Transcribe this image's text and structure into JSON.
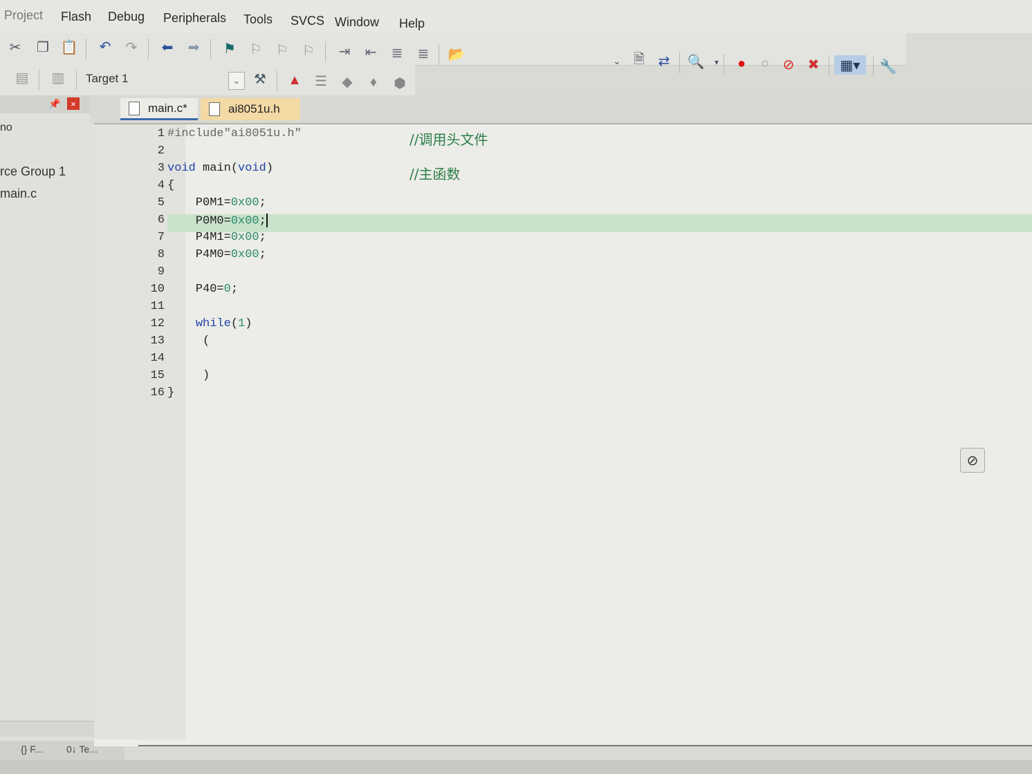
{
  "menu": [
    "Project",
    "Flash",
    "Debug",
    "Peripherals",
    "Tools",
    "SVCS",
    "Window",
    "Help"
  ],
  "toolbar": {
    "target": "Target 1"
  },
  "project_panel": {
    "items": [
      "no",
      "rce Group 1",
      "main.c"
    ]
  },
  "bottom_tabs": [
    "{} F...",
    "0↓ Te..."
  ],
  "tabs": [
    {
      "label": "main.c*",
      "active": true
    },
    {
      "label": "ai8051u.h",
      "active": false
    }
  ],
  "editor": {
    "line_numbers": [
      "1",
      "2",
      "3",
      "4",
      "5",
      "6",
      "7",
      "8",
      "9",
      "10",
      "11",
      "12",
      "13",
      "14",
      "15",
      "16"
    ],
    "code": {
      "l1_pp": "#include\"ai8051u.h\"",
      "l1_comment": "//调用头文件",
      "l3_kw1": "void",
      "l3_fn": " main(",
      "l3_kw2": "void",
      "l3_close": ")",
      "l3_comment": "//主函数",
      "l4": "{",
      "l5_var": "    P0M1=",
      "l5_val": "0x00",
      "l6_var": "    P0M0=",
      "l6_val": "0x00",
      "l7_var": "    P4M1=",
      "l7_val": "0x00",
      "l8_var": "    P4M0=",
      "l8_val": "0x00",
      "l10_var": "    P40=",
      "l10_val": "0",
      "l12_kw": "while",
      "l12_paren_open": "(",
      "l12_val": "1",
      "l12_paren_close": ")",
      "l13": "     (",
      "l15": "     )",
      "l16": "}",
      "semicolon": ";"
    }
  },
  "colors": {
    "current_line": "#c9e3cb",
    "keyword": "#2244aa",
    "number": "#2a8a6a",
    "comment": "#2e7d4a"
  }
}
